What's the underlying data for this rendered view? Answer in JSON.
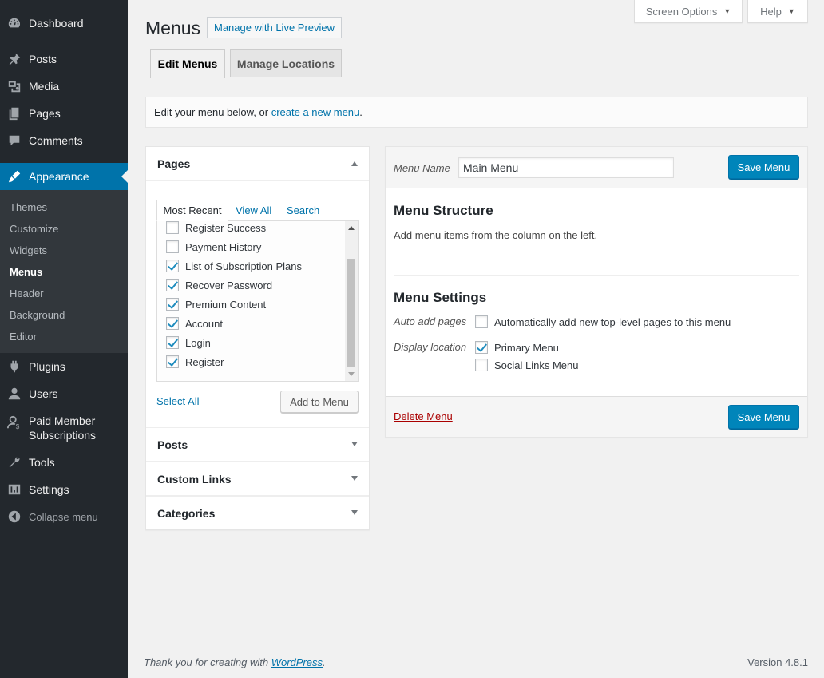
{
  "sidebar": {
    "items": [
      {
        "label": "Dashboard",
        "icon": "dashboard-icon"
      },
      {
        "label": "Posts",
        "icon": "pin-icon"
      },
      {
        "label": "Media",
        "icon": "media-icon"
      },
      {
        "label": "Pages",
        "icon": "pages-icon"
      },
      {
        "label": "Comments",
        "icon": "comments-icon"
      },
      {
        "label": "Appearance",
        "icon": "appearance-icon"
      },
      {
        "label": "Plugins",
        "icon": "plugins-icon"
      },
      {
        "label": "Users",
        "icon": "users-icon"
      },
      {
        "label": "Paid Member Subscriptions",
        "icon": "members-icon"
      },
      {
        "label": "Tools",
        "icon": "tools-icon"
      },
      {
        "label": "Settings",
        "icon": "settings-icon"
      }
    ],
    "submenu": [
      "Themes",
      "Customize",
      "Widgets",
      "Menus",
      "Header",
      "Background",
      "Editor"
    ],
    "collapse": "Collapse menu"
  },
  "screen_meta": {
    "screen_options": "Screen Options",
    "help": "Help"
  },
  "header": {
    "title": "Menus",
    "live_preview": "Manage with Live Preview"
  },
  "tabs": [
    "Edit Menus",
    "Manage Locations"
  ],
  "notice": {
    "prefix": "Edit your menu below, or ",
    "link": "create a new menu",
    "suffix": "."
  },
  "accordion": {
    "pages_title": "Pages",
    "page_tabs": [
      "Most Recent",
      "View All",
      "Search"
    ],
    "pages": [
      {
        "label": "Register Success",
        "checked": false
      },
      {
        "label": "Payment History",
        "checked": false
      },
      {
        "label": "List of Subscription Plans",
        "checked": true
      },
      {
        "label": "Recover Password",
        "checked": true
      },
      {
        "label": "Premium Content",
        "checked": true
      },
      {
        "label": "Account",
        "checked": true
      },
      {
        "label": "Login",
        "checked": true
      },
      {
        "label": "Register",
        "checked": true
      }
    ],
    "select_all": "Select All",
    "add_to_menu": "Add to Menu",
    "sections": [
      "Posts",
      "Custom Links",
      "Categories"
    ]
  },
  "menu_edit": {
    "name_label": "Menu Name",
    "name_value": "Main Menu",
    "save": "Save Menu",
    "structure_title": "Menu Structure",
    "structure_desc": "Add menu items from the column on the left.",
    "settings_title": "Menu Settings",
    "auto_add_label": "Auto add pages",
    "auto_add_option": "Automatically add new top-level pages to this menu",
    "display_label": "Display location",
    "locations": [
      {
        "label": "Primary Menu",
        "checked": true
      },
      {
        "label": "Social Links Menu",
        "checked": false
      }
    ],
    "delete": "Delete Menu"
  },
  "footer": {
    "thanks_prefix": "Thank you for creating with ",
    "thanks_link": "WordPress",
    "thanks_suffix": ".",
    "version": "Version 4.8.1"
  },
  "colors": {
    "sidebar_bg": "#23282d",
    "submenu_bg": "#32373c",
    "accent": "#0073aa",
    "primary_button": "#0085ba",
    "delete": "#aa0000"
  }
}
